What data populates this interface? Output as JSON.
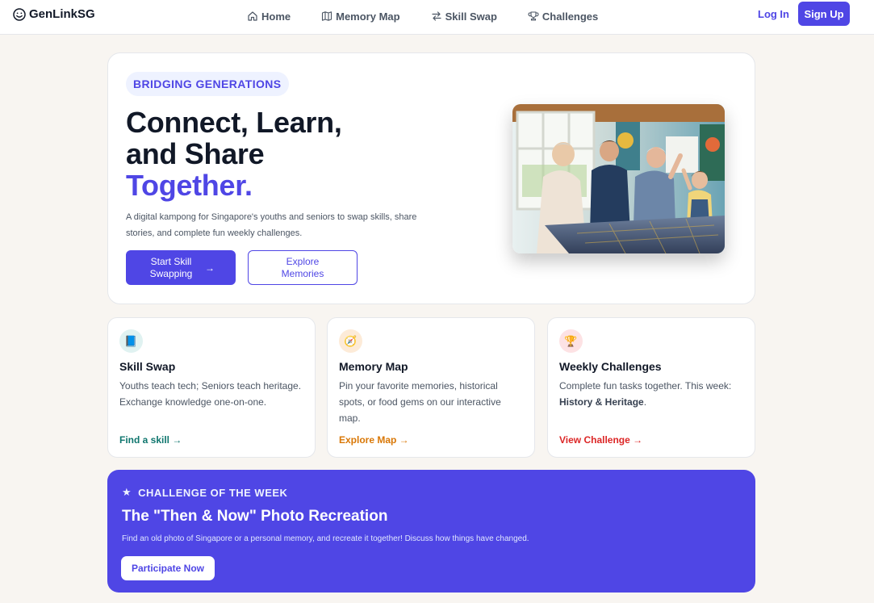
{
  "brand": {
    "name": "GenLinkSG",
    "icon": "smiley-icon"
  },
  "nav": {
    "items": [
      {
        "label": "Home",
        "icon": "home-icon"
      },
      {
        "label": "Memory Map",
        "icon": "map-icon"
      },
      {
        "label": "Skill Swap",
        "icon": "swap-arrows-icon"
      },
      {
        "label": "Challenges",
        "icon": "trophy-icon"
      }
    ],
    "login": "Log In",
    "signup": "Sign Up"
  },
  "hero": {
    "eyebrow": "BRIDGING GENERATIONS",
    "headline_line1": "Connect, Learn,",
    "headline_line2": "and Share",
    "headline_accent": "Together.",
    "description": "A digital kampong for Singapore's youths and seniors to swap skills, share stories, and complete fun weekly challenges.",
    "primary_button": "Start Skill Swapping",
    "primary_arrow": "→",
    "secondary_button": "Explore Memories",
    "image": "photo of seniors and youths playing a board game together"
  },
  "features": [
    {
      "icon": "book-icon",
      "icon_glyph": "📘",
      "icon_bg": "#e0f2f1",
      "title": "Skill Swap",
      "description": "Youths teach tech; Seniors teach heritage. Exchange knowledge one-on-one.",
      "link": "Find a skill →",
      "link_color": "#0f766e"
    },
    {
      "icon": "compass-icon",
      "icon_glyph": "🧭",
      "icon_bg": "#fdebd8",
      "title": "Memory Map",
      "description": "Pin your favorite memories, historical spots, or food gems on our interactive map.",
      "link": "Explore Map →",
      "link_color": "#d97706"
    },
    {
      "icon": "trophy-icon",
      "icon_glyph": "🏆",
      "icon_bg": "#fde2e4",
      "title": "Weekly Challenges",
      "description_prefix": "Complete fun tasks together. This week: ",
      "description_bold": "History & Heritage",
      "description_suffix": ".",
      "link": "View Challenge →",
      "link_color": "#dc2626"
    }
  ],
  "challenge": {
    "star": "★",
    "eyebrow": "CHALLENGE OF THE WEEK",
    "title": "The \"Then & Now\" Photo Recreation",
    "description": "Find an old photo of Singapore or a personal memory, and recreate it together! Discuss how things have changed.",
    "button": "Participate Now"
  },
  "colors": {
    "accent": "#4f46e5",
    "background": "#f8f5f1"
  }
}
